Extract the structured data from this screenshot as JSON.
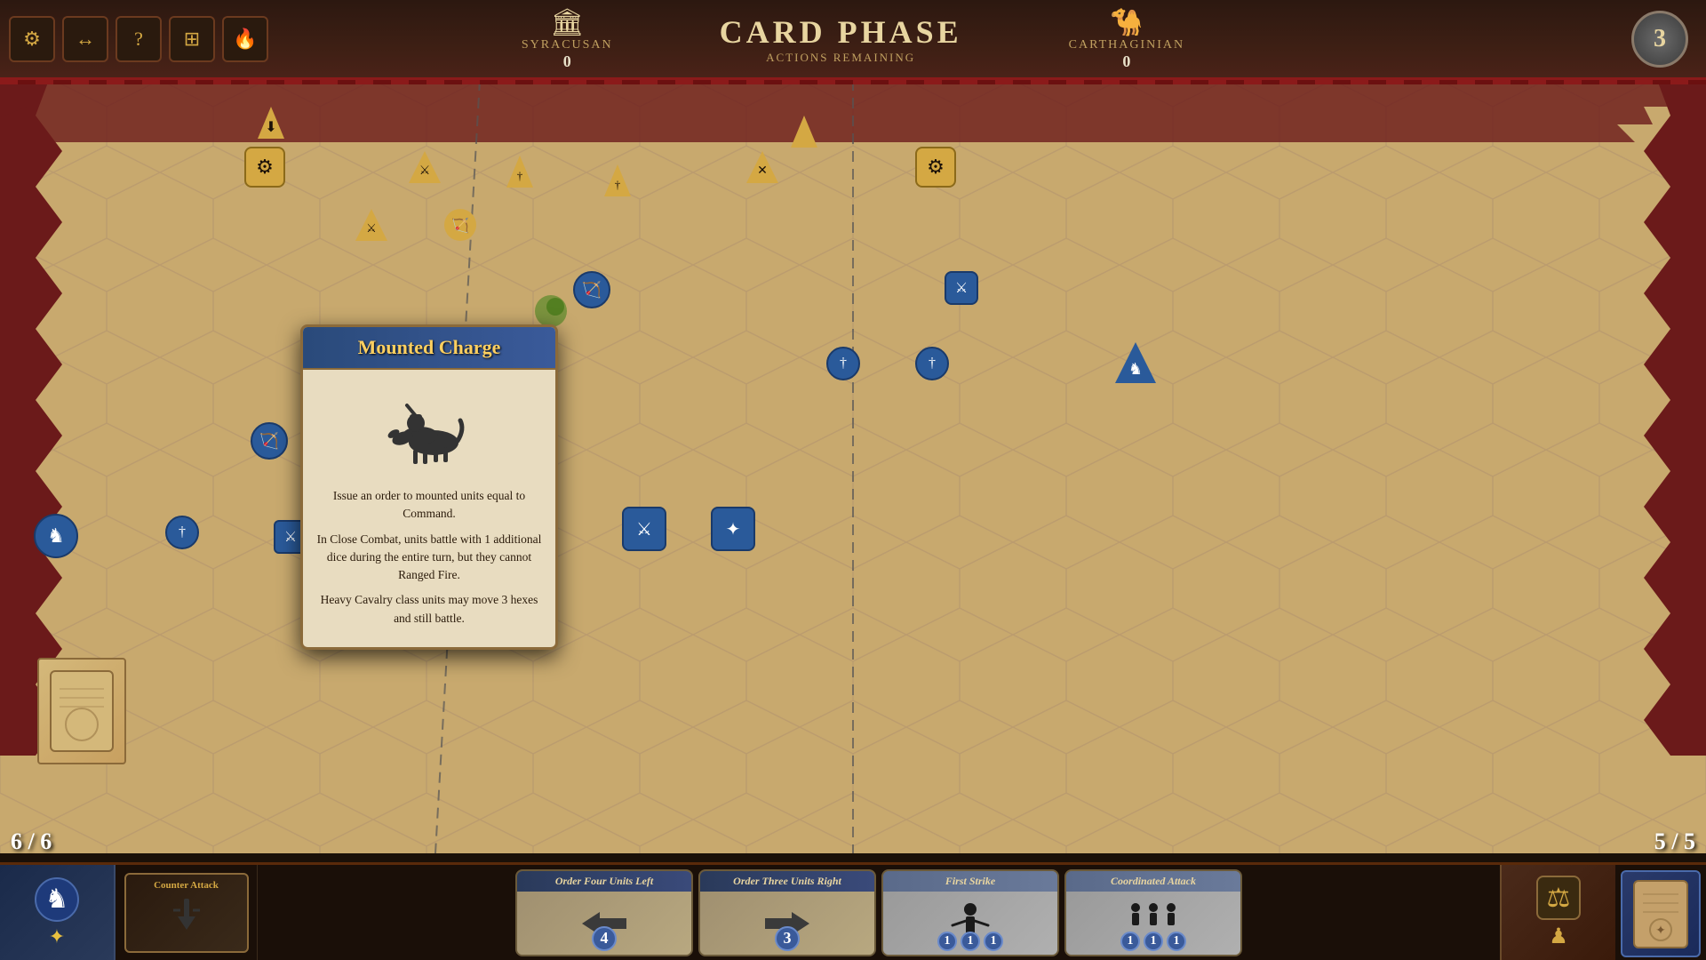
{
  "header": {
    "phase_title": "CARD PHASE",
    "actions_label": "ACTIONS REMAINING",
    "left_faction_name": "SYRACUSAN",
    "left_faction_count": "0",
    "right_faction_name": "CARTHAGINIAN",
    "right_faction_count": "0",
    "round_number": "3"
  },
  "toolbar": {
    "settings_icon": "⚙",
    "arrows_icon": "↕",
    "help_icon": "?",
    "map_icon": "⊞",
    "fire_icon": "🔥"
  },
  "card_popup": {
    "title": "Mounted Charge",
    "icon": "🐴",
    "text1": "Issue an order to mounted units equal to Command.",
    "text2": "In Close Combat, units battle with 1 additional dice during the entire turn, but they cannot Ranged Fire.",
    "text3": "Heavy Cavalry class units may move 3 hexes and still battle."
  },
  "bottom_cards": {
    "left_card_title": "Counter Attack",
    "card1_title": "Order Four Units Left",
    "card1_number": "4",
    "card2_title": "Order Three Units Right",
    "card2_number": "3",
    "card3_title": "First Strike",
    "card3_number_1": "1",
    "card3_number_2": "1",
    "card3_number_3": "1",
    "card4_title": "Coordinated Attack",
    "card4_number_1": "1",
    "card4_number_2": "1",
    "card4_number_3": "1"
  },
  "player_left": {
    "score": "6 / 6"
  },
  "player_right": {
    "score": "5 / 5"
  }
}
